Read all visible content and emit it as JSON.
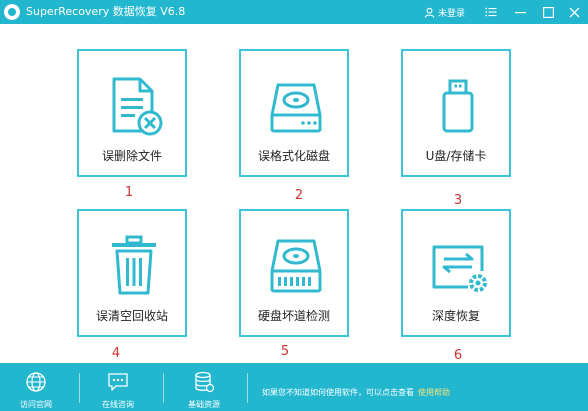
{
  "window": {
    "title": "SuperRecovery 数据恢复 V6.8",
    "user_label": "未登录",
    "accent": "#22b7cf"
  },
  "cards": [
    {
      "label": "误删除文件",
      "number": "1",
      "icon": "deleted-file-icon"
    },
    {
      "label": "误格式化磁盘",
      "number": "2",
      "icon": "hard-disk-icon"
    },
    {
      "label": "U盘/存储卡",
      "number": "3",
      "icon": "usb-drive-icon"
    },
    {
      "label": "误清空回收站",
      "number": "4",
      "icon": "recycle-bin-icon"
    },
    {
      "label": "硬盘坏道检测",
      "number": "5",
      "icon": "disk-scan-icon"
    },
    {
      "label": "深度恢复",
      "number": "6",
      "icon": "deep-recovery-icon"
    }
  ],
  "footer": {
    "items": [
      {
        "label": "访问官网",
        "icon": "globe-icon"
      },
      {
        "label": "在线咨询",
        "icon": "chat-icon"
      },
      {
        "label": "基础资源",
        "icon": "database-icon"
      }
    ],
    "notice": "如果您不知道如何使用软件，可以点击查看",
    "link": "使用帮助"
  },
  "colors": {
    "card_border": "#3cc3d8",
    "number_red": "#cf3333",
    "link_yellow": "#f4e27a"
  }
}
